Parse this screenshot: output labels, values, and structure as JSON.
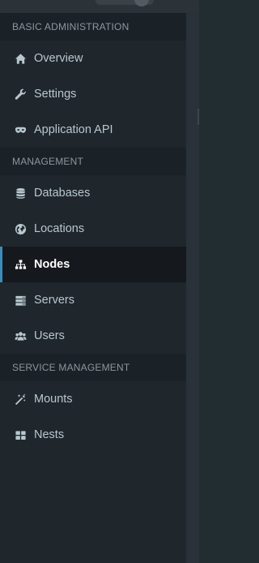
{
  "sidebar": {
    "sections": [
      {
        "title": "BASIC ADMINISTRATION",
        "items": [
          {
            "label": "Overview",
            "icon": "home-icon"
          },
          {
            "label": "Settings",
            "icon": "wrench-icon"
          },
          {
            "label": "Application API",
            "icon": "mask-icon"
          }
        ]
      },
      {
        "title": "MANAGEMENT",
        "items": [
          {
            "label": "Databases",
            "icon": "database-icon"
          },
          {
            "label": "Locations",
            "icon": "globe-icon"
          },
          {
            "label": "Nodes",
            "icon": "sitemap-icon",
            "active": true
          },
          {
            "label": "Servers",
            "icon": "server-icon"
          },
          {
            "label": "Users",
            "icon": "users-icon"
          }
        ]
      },
      {
        "title": "SERVICE MANAGEMENT",
        "items": [
          {
            "label": "Mounts",
            "icon": "magic-wand-icon"
          },
          {
            "label": "Nests",
            "icon": "th-large-icon"
          }
        ]
      }
    ]
  },
  "colors": {
    "sidebar_bg": "#1f262c",
    "header_bg": "#1b2227",
    "active_bg": "#15191d",
    "active_accent": "#3c8dbc",
    "text": "#b8c7ce",
    "header_text": "#8c969e"
  }
}
